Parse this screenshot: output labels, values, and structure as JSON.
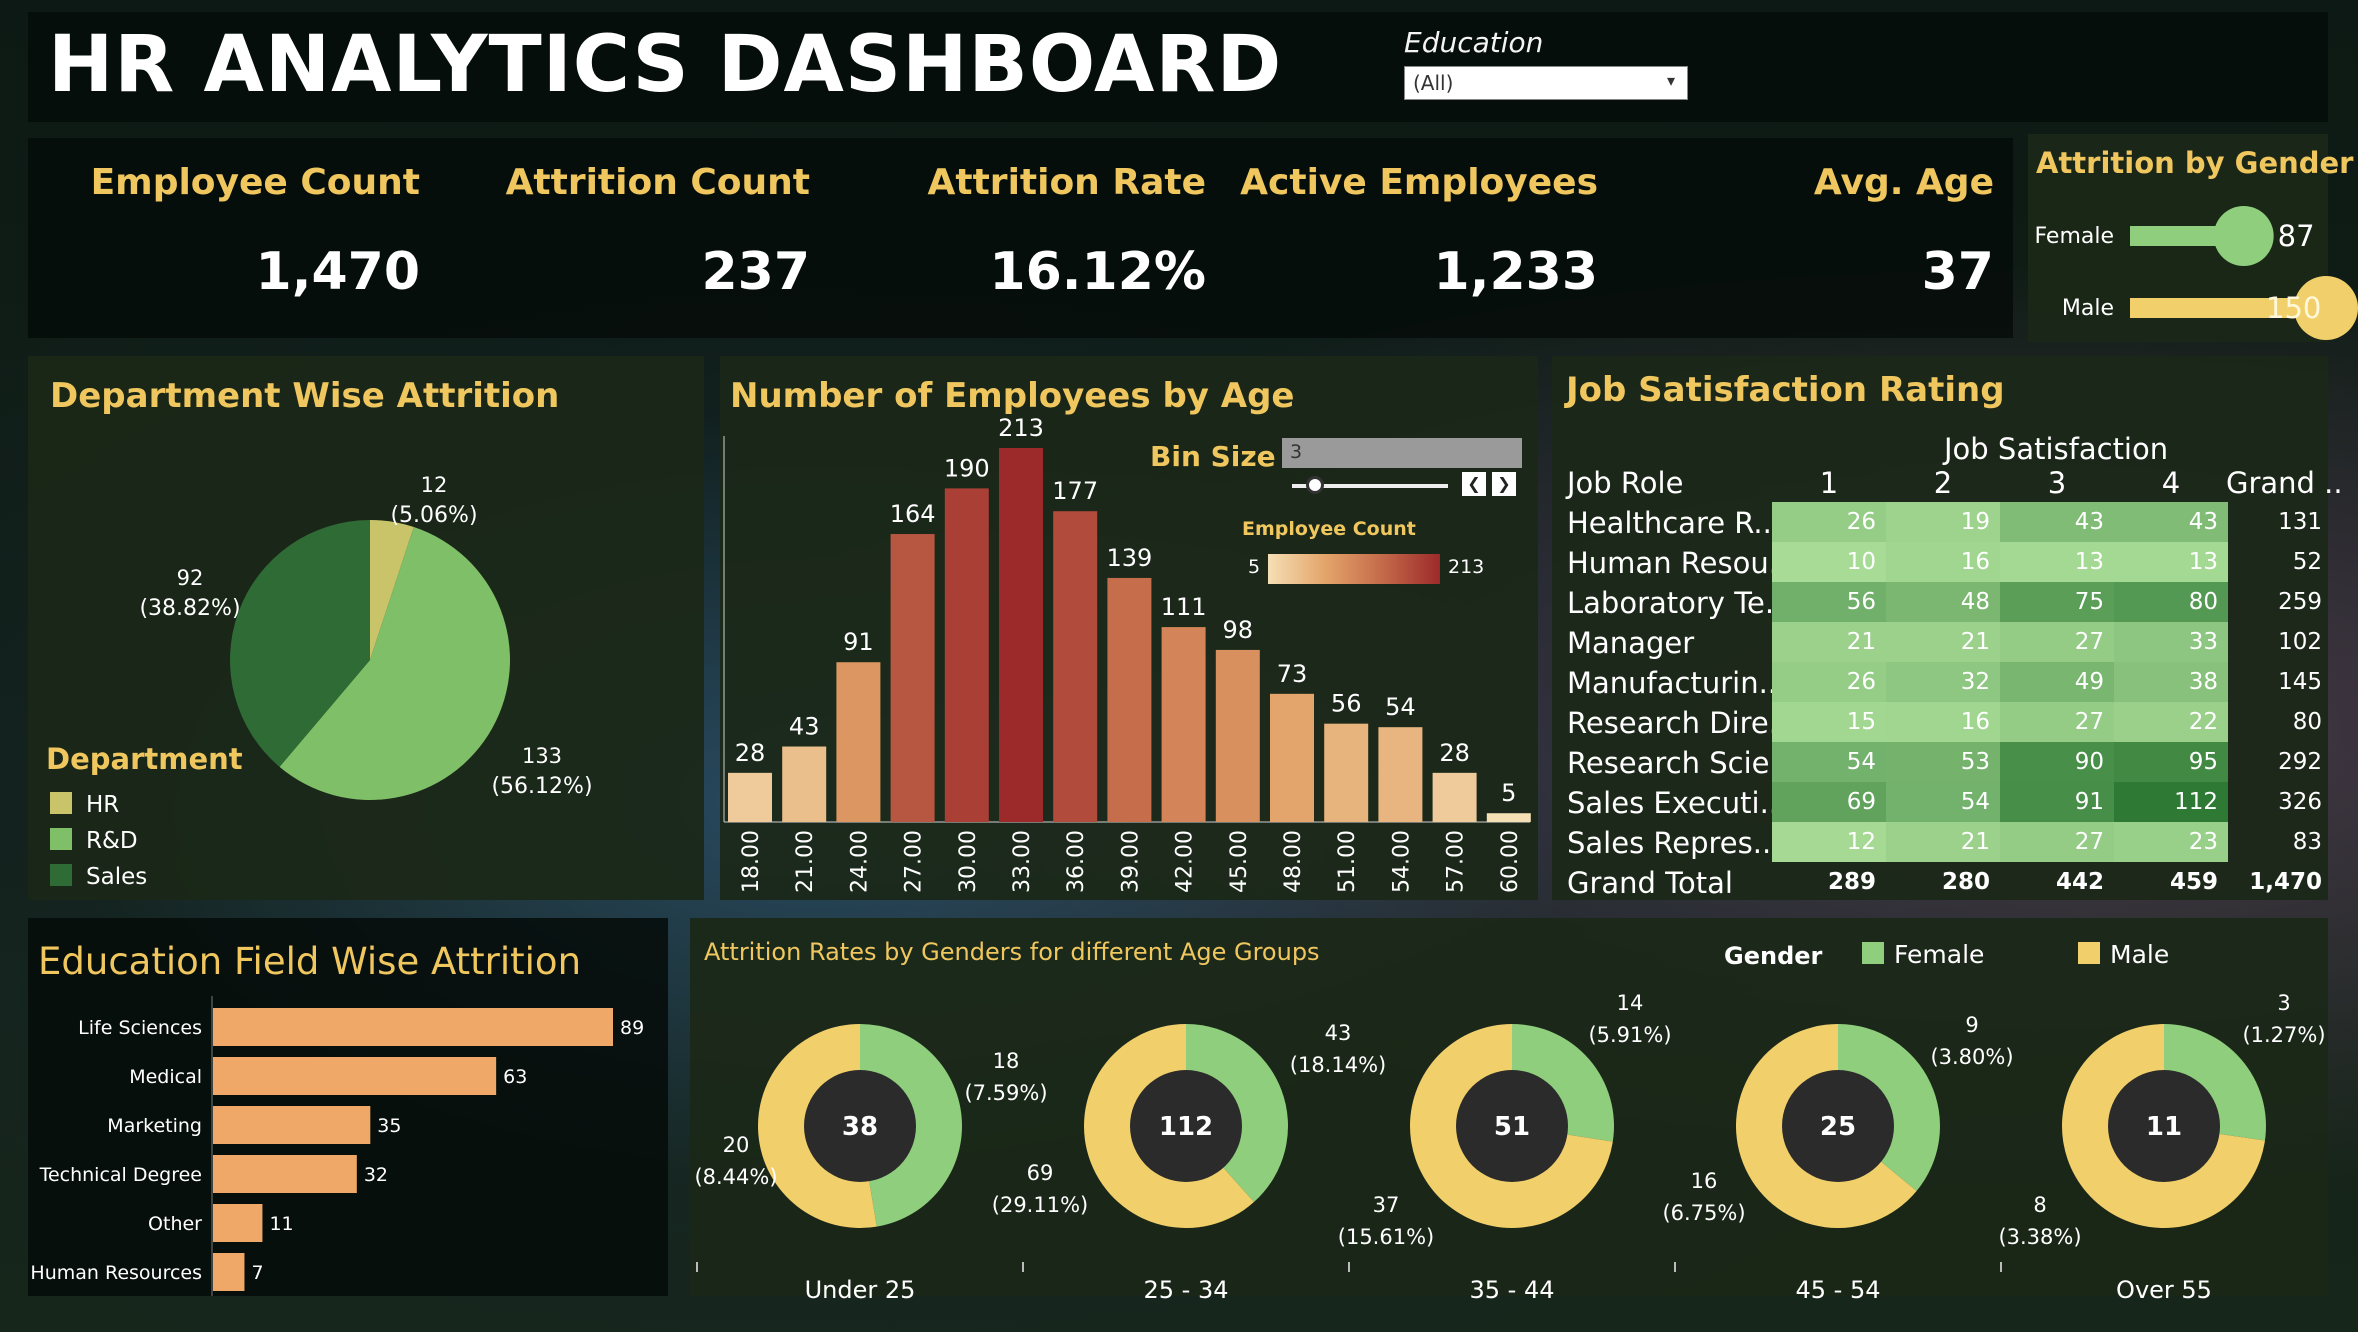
{
  "header": {
    "title": "HR ANALYTICS DASHBOARD",
    "filter_label": "Education",
    "filter_value": "(All)"
  },
  "kpis": [
    {
      "label": "Employee Count",
      "value": "1,470"
    },
    {
      "label": "Attrition Count",
      "value": "237"
    },
    {
      "label": "Attrition Rate",
      "value": "16.12%"
    },
    {
      "label": "Active Employees",
      "value": "1,233"
    },
    {
      "label": "Avg. Age",
      "value": "37"
    }
  ],
  "colors": {
    "gold": "#f0c75e",
    "female": "#8fce7c",
    "male": "#f1cf6b",
    "hr": "#c9c46a",
    "rnd": "#7fbf68",
    "sales": "#2f6b35",
    "bar_orange": "#f0a868",
    "donut_center": "#2b2b2b"
  },
  "chart_data": [
    {
      "id": "gender",
      "type": "bar",
      "title": "Attrition by Gender",
      "categories": [
        "Female",
        "Male"
      ],
      "values": [
        87,
        150
      ],
      "colors": [
        "#8fce7c",
        "#f1cf6b"
      ]
    },
    {
      "id": "department",
      "type": "pie",
      "title": "Department Wise Attrition",
      "legend_title": "Department",
      "legend_placement": "bottom-left",
      "slices": [
        {
          "name": "HR",
          "value": 12,
          "pct": "(5.06%)",
          "color": "#c9c46a"
        },
        {
          "name": "R&D",
          "value": 133,
          "pct": "(56.12%)",
          "color": "#7fbf68"
        },
        {
          "name": "Sales",
          "value": 92,
          "pct": "(38.82%)",
          "color": "#2f6b35"
        }
      ]
    },
    {
      "id": "age",
      "type": "bar",
      "title": "Number of Employees by Age",
      "categories": [
        "18.00",
        "21.00",
        "24.00",
        "27.00",
        "30.00",
        "33.00",
        "36.00",
        "39.00",
        "42.00",
        "45.00",
        "48.00",
        "51.00",
        "54.00",
        "57.00",
        "60.00"
      ],
      "values": [
        28,
        43,
        91,
        164,
        190,
        213,
        177,
        139,
        111,
        98,
        73,
        56,
        54,
        28,
        5
      ],
      "bin_size_label": "Bin Size",
      "bin_size_value": "3",
      "color_legend_title": "Employee Count",
      "color_min": 5,
      "color_max": 213,
      "ylim": [
        0,
        213
      ]
    },
    {
      "id": "job_satisfaction",
      "type": "table",
      "title": "Job Satisfaction Rating",
      "column_group": "Job Satisfaction",
      "row_header": "Job Role",
      "columns": [
        "1",
        "2",
        "3",
        "4"
      ],
      "grand_label": "Grand ..",
      "rows": [
        {
          "role": "Healthcare R..",
          "values": [
            26,
            19,
            43,
            43
          ],
          "total": "131"
        },
        {
          "role": "Human Resou..",
          "values": [
            10,
            16,
            13,
            13
          ],
          "total": "52"
        },
        {
          "role": "Laboratory Te..",
          "values": [
            56,
            48,
            75,
            80
          ],
          "total": "259"
        },
        {
          "role": "Manager",
          "values": [
            21,
            21,
            27,
            33
          ],
          "total": "102"
        },
        {
          "role": "Manufacturin..",
          "values": [
            26,
            32,
            49,
            38
          ],
          "total": "145"
        },
        {
          "role": "Research Dire..",
          "values": [
            15,
            16,
            27,
            22
          ],
          "total": "80"
        },
        {
          "role": "Research Scie..",
          "values": [
            54,
            53,
            90,
            95
          ],
          "total": "292"
        },
        {
          "role": "Sales Executi..",
          "values": [
            69,
            54,
            91,
            112
          ],
          "total": "326"
        },
        {
          "role": "Sales Repres..",
          "values": [
            12,
            21,
            27,
            23
          ],
          "total": "83"
        }
      ],
      "grand_total_label": "Grand Total",
      "grand_totals": [
        "289",
        "280",
        "442",
        "459",
        "1,470"
      ]
    },
    {
      "id": "education_field",
      "type": "bar",
      "title": "Education Field Wise Attrition",
      "categories": [
        "Life Sciences",
        "Medical",
        "Marketing",
        "Technical Degree",
        "Other",
        "Human Resources"
      ],
      "values": [
        89,
        63,
        35,
        32,
        11,
        7
      ]
    },
    {
      "id": "age_gender",
      "type": "pie",
      "title": "Attrition Rates by Genders for different Age Groups",
      "legend_title": "Gender",
      "legend_placement": "top-right",
      "legend": [
        {
          "name": "Female",
          "color": "#8fce7c"
        },
        {
          "name": "Male",
          "color": "#f1cf6b"
        }
      ],
      "groups": [
        {
          "label": "Under 25",
          "total": "38",
          "female": 18,
          "female_pct": "(7.59%)",
          "male": 20,
          "male_pct": "(8.44%)"
        },
        {
          "label": "25 - 34",
          "total": "112",
          "female": 43,
          "female_pct": "(18.14%)",
          "male": 69,
          "male_pct": "(29.11%)"
        },
        {
          "label": "35 - 44",
          "total": "51",
          "female": 14,
          "female_pct": "(5.91%)",
          "male": 37,
          "male_pct": "(15.61%)"
        },
        {
          "label": "45 - 54",
          "total": "25",
          "female": 9,
          "female_pct": "(3.80%)",
          "male": 16,
          "male_pct": "(6.75%)"
        },
        {
          "label": "Over 55",
          "total": "11",
          "female": 3,
          "female_pct": "(1.27%)",
          "male": 8,
          "male_pct": "(3.38%)"
        }
      ]
    }
  ]
}
